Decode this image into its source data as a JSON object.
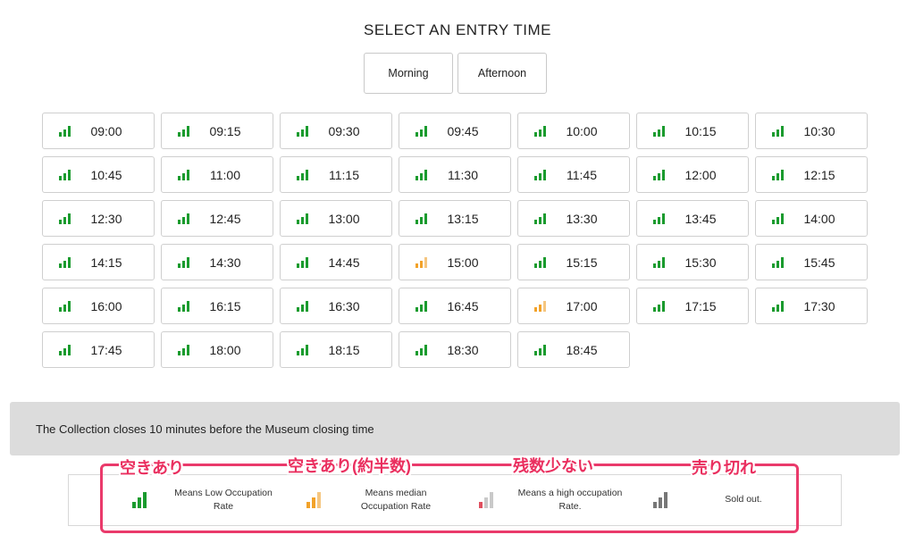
{
  "title": "SELECT AN ENTRY TIME",
  "tabs": [
    {
      "label": "Morning"
    },
    {
      "label": "Afternoon"
    }
  ],
  "colors": {
    "low": "#1a9b2e",
    "median": "#f2a229",
    "high": "#e88a94",
    "soldout": "#777777",
    "annotation": "#ea2f5f"
  },
  "slots": [
    {
      "time": "09:00",
      "occupancy": "low"
    },
    {
      "time": "09:15",
      "occupancy": "low"
    },
    {
      "time": "09:30",
      "occupancy": "low"
    },
    {
      "time": "09:45",
      "occupancy": "low"
    },
    {
      "time": "10:00",
      "occupancy": "low"
    },
    {
      "time": "10:15",
      "occupancy": "low"
    },
    {
      "time": "10:30",
      "occupancy": "low"
    },
    {
      "time": "10:45",
      "occupancy": "low"
    },
    {
      "time": "11:00",
      "occupancy": "low"
    },
    {
      "time": "11:15",
      "occupancy": "low"
    },
    {
      "time": "11:30",
      "occupancy": "low"
    },
    {
      "time": "11:45",
      "occupancy": "low"
    },
    {
      "time": "12:00",
      "occupancy": "low"
    },
    {
      "time": "12:15",
      "occupancy": "low"
    },
    {
      "time": "12:30",
      "occupancy": "low"
    },
    {
      "time": "12:45",
      "occupancy": "low"
    },
    {
      "time": "13:00",
      "occupancy": "low"
    },
    {
      "time": "13:15",
      "occupancy": "low"
    },
    {
      "time": "13:30",
      "occupancy": "low"
    },
    {
      "time": "13:45",
      "occupancy": "low"
    },
    {
      "time": "14:00",
      "occupancy": "low"
    },
    {
      "time": "14:15",
      "occupancy": "low"
    },
    {
      "time": "14:30",
      "occupancy": "low"
    },
    {
      "time": "14:45",
      "occupancy": "low"
    },
    {
      "time": "15:00",
      "occupancy": "median"
    },
    {
      "time": "15:15",
      "occupancy": "low"
    },
    {
      "time": "15:30",
      "occupancy": "low"
    },
    {
      "time": "15:45",
      "occupancy": "low"
    },
    {
      "time": "16:00",
      "occupancy": "low"
    },
    {
      "time": "16:15",
      "occupancy": "low"
    },
    {
      "time": "16:30",
      "occupancy": "low"
    },
    {
      "time": "16:45",
      "occupancy": "low"
    },
    {
      "time": "17:00",
      "occupancy": "median"
    },
    {
      "time": "17:15",
      "occupancy": "low"
    },
    {
      "time": "17:30",
      "occupancy": "low"
    },
    {
      "time": "17:45",
      "occupancy": "low"
    },
    {
      "time": "18:00",
      "occupancy": "low"
    },
    {
      "time": "18:15",
      "occupancy": "low"
    },
    {
      "time": "18:30",
      "occupancy": "low"
    },
    {
      "time": "18:45",
      "occupancy": "low"
    }
  ],
  "notice": "The Collection closes 10 minutes before the Museum closing time",
  "legend": [
    {
      "level": "low",
      "desc_line1": "Means Low Occupation",
      "desc_line2": "Rate",
      "jp_label": "空きあり"
    },
    {
      "level": "median",
      "desc_line1": "Means median",
      "desc_line2": "Occupation Rate",
      "jp_label": "空きあり(約半数)"
    },
    {
      "level": "high",
      "desc_line1": "Means a high occupation",
      "desc_line2": "Rate.",
      "jp_label": "残数少ない"
    },
    {
      "level": "soldout",
      "desc_line1": "Sold out.",
      "desc_line2": "",
      "jp_label": "売り切れ"
    }
  ]
}
